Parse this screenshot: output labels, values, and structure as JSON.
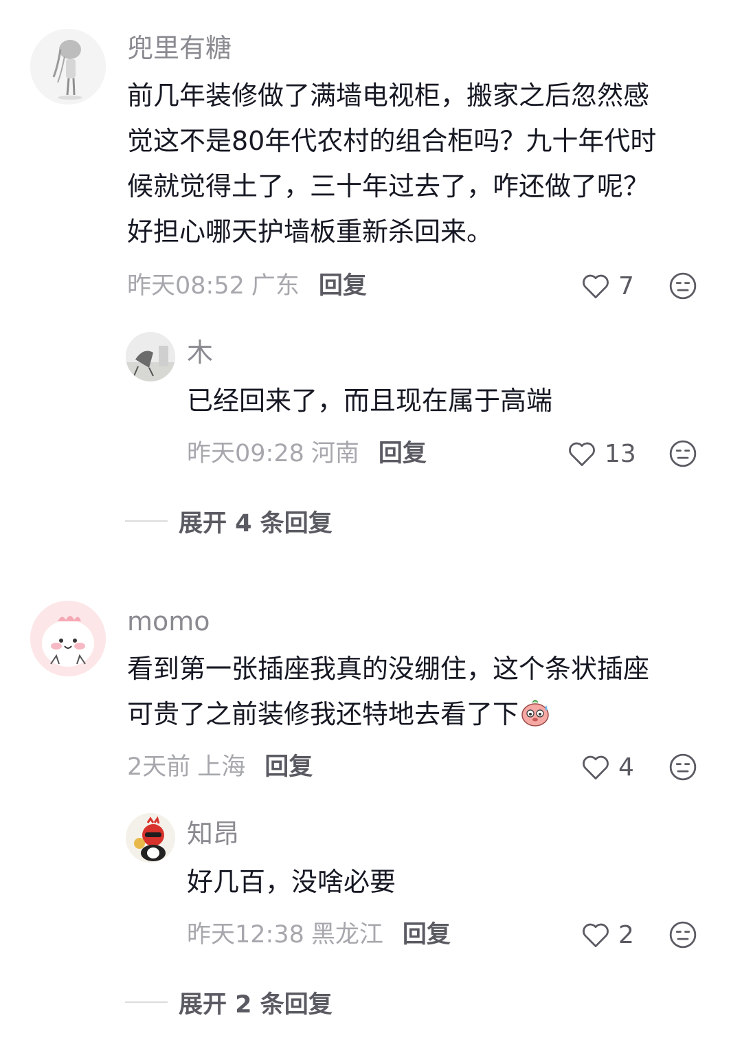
{
  "comments": [
    {
      "username": "兜里有糖",
      "text_lines": [
        "前几年装修做了满墙电视柜，搬家之后忽然感",
        "觉这不是80年代农村的组合柜吗？九十年代时",
        "候就觉得土了，三十年过去了，咋还做了呢？",
        "好担心哪天护墙板重新杀回来。"
      ],
      "time": "昨天08:52",
      "location": "广东",
      "reply_label": "回复",
      "likes": "7",
      "replies": [
        {
          "username": "木",
          "text": "已经回来了，而且现在属于高端",
          "time": "昨天09:28",
          "location": "河南",
          "reply_label": "回复",
          "likes": "13"
        }
      ],
      "expand_label": "展开 4 条回复"
    },
    {
      "username": "momo",
      "text_lines": [
        "看到第一张插座我真的没绷住，这个条状插座",
        "可贵了之前装修我还特地去看了下"
      ],
      "inline_emoji": "sweat-pig-emoji",
      "time": "2天前",
      "location": "上海",
      "reply_label": "回复",
      "likes": "4",
      "replies": [
        {
          "username": "知昂",
          "text": "好几百，没啥必要",
          "time": "昨天12:38",
          "location": "黑龙江",
          "reply_label": "回复",
          "likes": "2"
        }
      ],
      "expand_label": "展开 2 条回复"
    }
  ],
  "icons": {
    "like": "heart-outline-icon",
    "emoji": "neutral-face-icon"
  },
  "colors": {
    "text": "#161823",
    "muted": "#a7a8ad",
    "username": "#8a8b91",
    "action": "#5a5b62"
  }
}
